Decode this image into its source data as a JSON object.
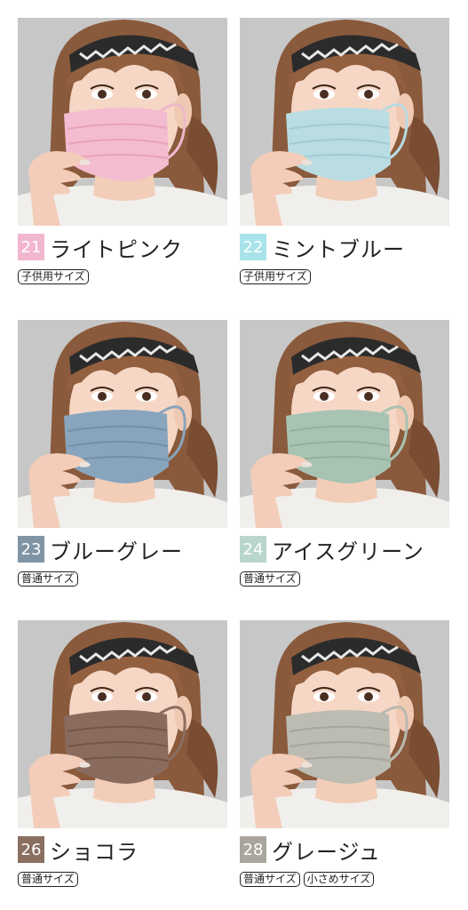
{
  "products": [
    {
      "number": "21",
      "name": "ライトピンク",
      "number_color": "#f2b7cf",
      "mask_color": "#f4bcd0",
      "mask_shade": "#e6a3bb",
      "band_color": "#efb8cc",
      "sizes": [
        "子供用サイズ"
      ]
    },
    {
      "number": "22",
      "name": "ミントブルー",
      "number_color": "#a9e3ea",
      "mask_color": "#b9dde3",
      "mask_shade": "#a1cbd3",
      "band_color": "#b7dbe2",
      "sizes": [
        "子供用サイズ"
      ]
    },
    {
      "number": "23",
      "name": "ブルーグレー",
      "number_color": "#7f95a6",
      "mask_color": "#88a5bd",
      "mask_shade": "#7290a8",
      "band_color": "#8aa4b9",
      "sizes": [
        "普通サイズ"
      ]
    },
    {
      "number": "24",
      "name": "アイスグリーン",
      "number_color": "#b9d6cb",
      "mask_color": "#a9c3b3",
      "mask_shade": "#94b09f",
      "band_color": "#a8c2b2",
      "sizes": [
        "普通サイズ"
      ]
    },
    {
      "number": "26",
      "name": "ショコラ",
      "number_color": "#8a6f60",
      "mask_color": "#8a6c5f",
      "mask_shade": "#735649",
      "band_color": "#8b6e60",
      "sizes": [
        "普通サイズ"
      ]
    },
    {
      "number": "28",
      "name": "グレージュ",
      "number_color": "#aaa69d",
      "mask_color": "#bcbcb2",
      "mask_shade": "#a6a69c",
      "band_color": "#bab9b0",
      "sizes": [
        "普通サイズ",
        "小さめサイズ"
      ]
    }
  ]
}
